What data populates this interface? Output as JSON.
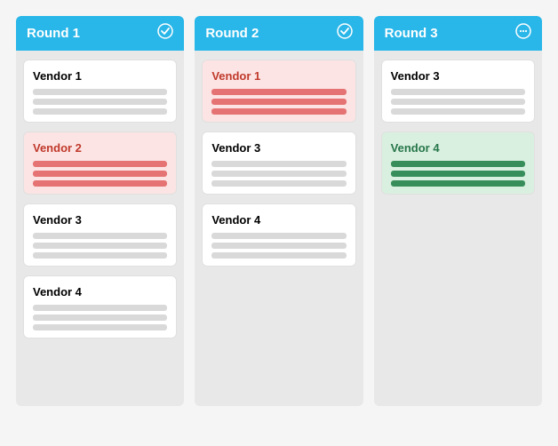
{
  "rounds": [
    {
      "id": "round1",
      "label": "Round 1",
      "icon": "✓",
      "icon_type": "check",
      "cards": [
        {
          "id": "r1-vendor1",
          "title": "Vendor 1",
          "state": "normal",
          "lines": 3
        },
        {
          "id": "r1-vendor2",
          "title": "Vendor 2",
          "state": "rejected",
          "lines": 3
        },
        {
          "id": "r1-vendor3",
          "title": "Vendor 3",
          "state": "normal",
          "lines": 3
        },
        {
          "id": "r1-vendor4",
          "title": "Vendor 4",
          "state": "normal",
          "lines": 3
        }
      ]
    },
    {
      "id": "round2",
      "label": "Round 2",
      "icon": "✓",
      "icon_type": "check",
      "cards": [
        {
          "id": "r2-vendor1",
          "title": "Vendor 1",
          "state": "rejected",
          "lines": 3
        },
        {
          "id": "r2-vendor3",
          "title": "Vendor 3",
          "state": "normal",
          "lines": 3
        },
        {
          "id": "r2-vendor4",
          "title": "Vendor 4",
          "state": "normal",
          "lines": 3
        }
      ]
    },
    {
      "id": "round3",
      "label": "Round 3",
      "icon": "···",
      "icon_type": "ellipsis",
      "cards": [
        {
          "id": "r3-vendor3",
          "title": "Vendor 3",
          "state": "normal",
          "lines": 3
        },
        {
          "id": "r3-vendor4",
          "title": "Vendor 4",
          "state": "accepted",
          "lines": 3
        }
      ]
    }
  ]
}
